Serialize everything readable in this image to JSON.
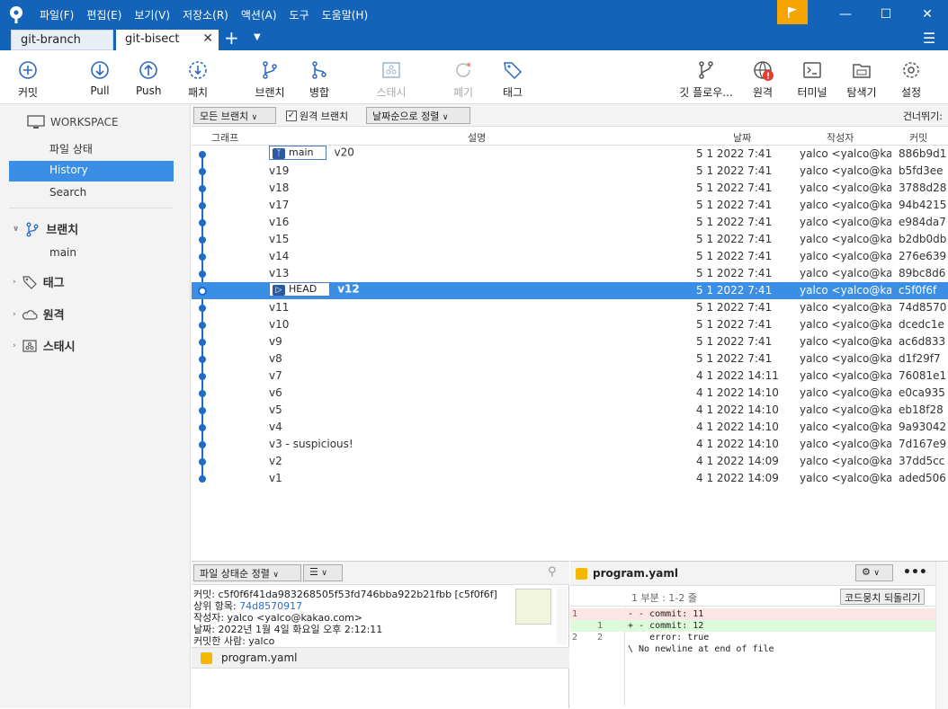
{
  "menu": [
    "파일(F)",
    "편집(E)",
    "보기(V)",
    "저장소(R)",
    "액션(A)",
    "도구",
    "도움말(H)"
  ],
  "tabs": [
    {
      "label": "git-branch"
    },
    {
      "label": "git-bisect"
    }
  ],
  "toolbar": {
    "commit": "커밋",
    "pull": "Pull",
    "push": "Push",
    "fetch": "패치",
    "branch": "브랜치",
    "merge": "병합",
    "stash": "스태시",
    "discard": "폐기",
    "tag": "태그",
    "gitflow": "깃 플로우...",
    "remote": "원격",
    "terminal": "터미널",
    "explorer": "탐색기",
    "settings": "설정"
  },
  "sidebar": {
    "workspace": "WORKSPACE",
    "ws_items": [
      "파일 상태",
      "History",
      "Search"
    ],
    "branches": "브랜치",
    "branch_items": [
      "main"
    ],
    "tags": "태그",
    "remotes": "원격",
    "stashes": "스태시"
  },
  "filter": {
    "branches_dd": "모든 브랜치",
    "remote_check": "원격 브랜치",
    "sort_dd": "날짜순으로 정렬",
    "skip": "건너뛰기:"
  },
  "columns": {
    "graph": "그래프",
    "desc": "설명",
    "date": "날짜",
    "author": "작성자",
    "commit": "커밋"
  },
  "commits": [
    {
      "msg": "v20",
      "badge": "main",
      "date": "5 1 2022 7:41",
      "author": "yalco <yalco@kak",
      "hash": "886b9d1"
    },
    {
      "msg": "v19",
      "date": "5 1 2022 7:41",
      "author": "yalco <yalco@kak",
      "hash": "b5fd3ee"
    },
    {
      "msg": "v18",
      "date": "5 1 2022 7:41",
      "author": "yalco <yalco@kak",
      "hash": "3788d28"
    },
    {
      "msg": "v17",
      "date": "5 1 2022 7:41",
      "author": "yalco <yalco@kak",
      "hash": "94b4215"
    },
    {
      "msg": "v16",
      "date": "5 1 2022 7:41",
      "author": "yalco <yalco@kak",
      "hash": "e984da7"
    },
    {
      "msg": "v15",
      "date": "5 1 2022 7:41",
      "author": "yalco <yalco@kak",
      "hash": "b2db0db"
    },
    {
      "msg": "v14",
      "date": "5 1 2022 7:41",
      "author": "yalco <yalco@kak",
      "hash": "276e639"
    },
    {
      "msg": "v13",
      "date": "5 1 2022 7:41",
      "author": "yalco <yalco@kak",
      "hash": "89bc8d6"
    },
    {
      "msg": "v12",
      "badge": "HEAD",
      "selected": true,
      "date": "5 1 2022 7:41",
      "author": "yalco <yalco@kak",
      "hash": "c5f0f6f"
    },
    {
      "msg": "v11",
      "date": "5 1 2022 7:41",
      "author": "yalco <yalco@kak",
      "hash": "74d8570"
    },
    {
      "msg": "v10",
      "date": "5 1 2022 7:41",
      "author": "yalco <yalco@kak",
      "hash": "dcedc1e"
    },
    {
      "msg": "v9",
      "date": "5 1 2022 7:41",
      "author": "yalco <yalco@kak",
      "hash": "ac6d833"
    },
    {
      "msg": "v8",
      "date": "5 1 2022 7:41",
      "author": "yalco <yalco@kak",
      "hash": "d1f29f7"
    },
    {
      "msg": "v7",
      "date": "4 1 2022 14:11",
      "author": "yalco <yalco@kak",
      "hash": "76081e1"
    },
    {
      "msg": "v6",
      "date": "4 1 2022 14:10",
      "author": "yalco <yalco@kak",
      "hash": "e0ca935"
    },
    {
      "msg": "v5",
      "date": "4 1 2022 14:10",
      "author": "yalco <yalco@kak",
      "hash": "eb18f28"
    },
    {
      "msg": "v4",
      "date": "4 1 2022 14:10",
      "author": "yalco <yalco@kak",
      "hash": "9a93042"
    },
    {
      "msg": "v3 - suspicious!",
      "date": "4 1 2022 14:10",
      "author": "yalco <yalco@kak",
      "hash": "7d167e9"
    },
    {
      "msg": "v2",
      "date": "4 1 2022 14:09",
      "author": "yalco <yalco@kak",
      "hash": "37dd5cc"
    },
    {
      "msg": "v1",
      "date": "4 1 2022 14:09",
      "author": "yalco <yalco@kak",
      "hash": "aded506"
    }
  ],
  "detail": {
    "sort_dd": "파일 상태순 정렬",
    "commit_line": "커밋: c5f0f6f41da983268505f53fd746bba922b21fbb [c5f0f6f]",
    "parent_label": "상위 항목: ",
    "parent_hash": "74d8570917",
    "author_line": "작성자: yalco <yalco@kakao.com>",
    "date_line": "날짜: 2022년 1월 4일 화요일 오후 2:12:11",
    "committer_line": "커밋한 사람: yalco",
    "file": "program.yaml"
  },
  "diff": {
    "file": "program.yaml",
    "hunk": "1 부분 : 1-2 줄",
    "discard_btn": "코드뭉치 되돌리기",
    "lines": [
      {
        "n1": "1",
        "n2": "",
        "code": "- - commit: 11",
        "type": "del"
      },
      {
        "n1": "",
        "n2": "1",
        "code": "+ - commit: 12",
        "type": "add"
      },
      {
        "n1": "2",
        "n2": "2",
        "code": "    error: true",
        "type": "ctx"
      },
      {
        "n1": "",
        "n2": "",
        "code": "\\ No newline at end of file",
        "type": "ctx"
      }
    ]
  },
  "colors": {
    "accent": "#1363b8",
    "selection": "#3a8ee6",
    "graph": "#1d6cc7",
    "warn": "#f6a400"
  }
}
